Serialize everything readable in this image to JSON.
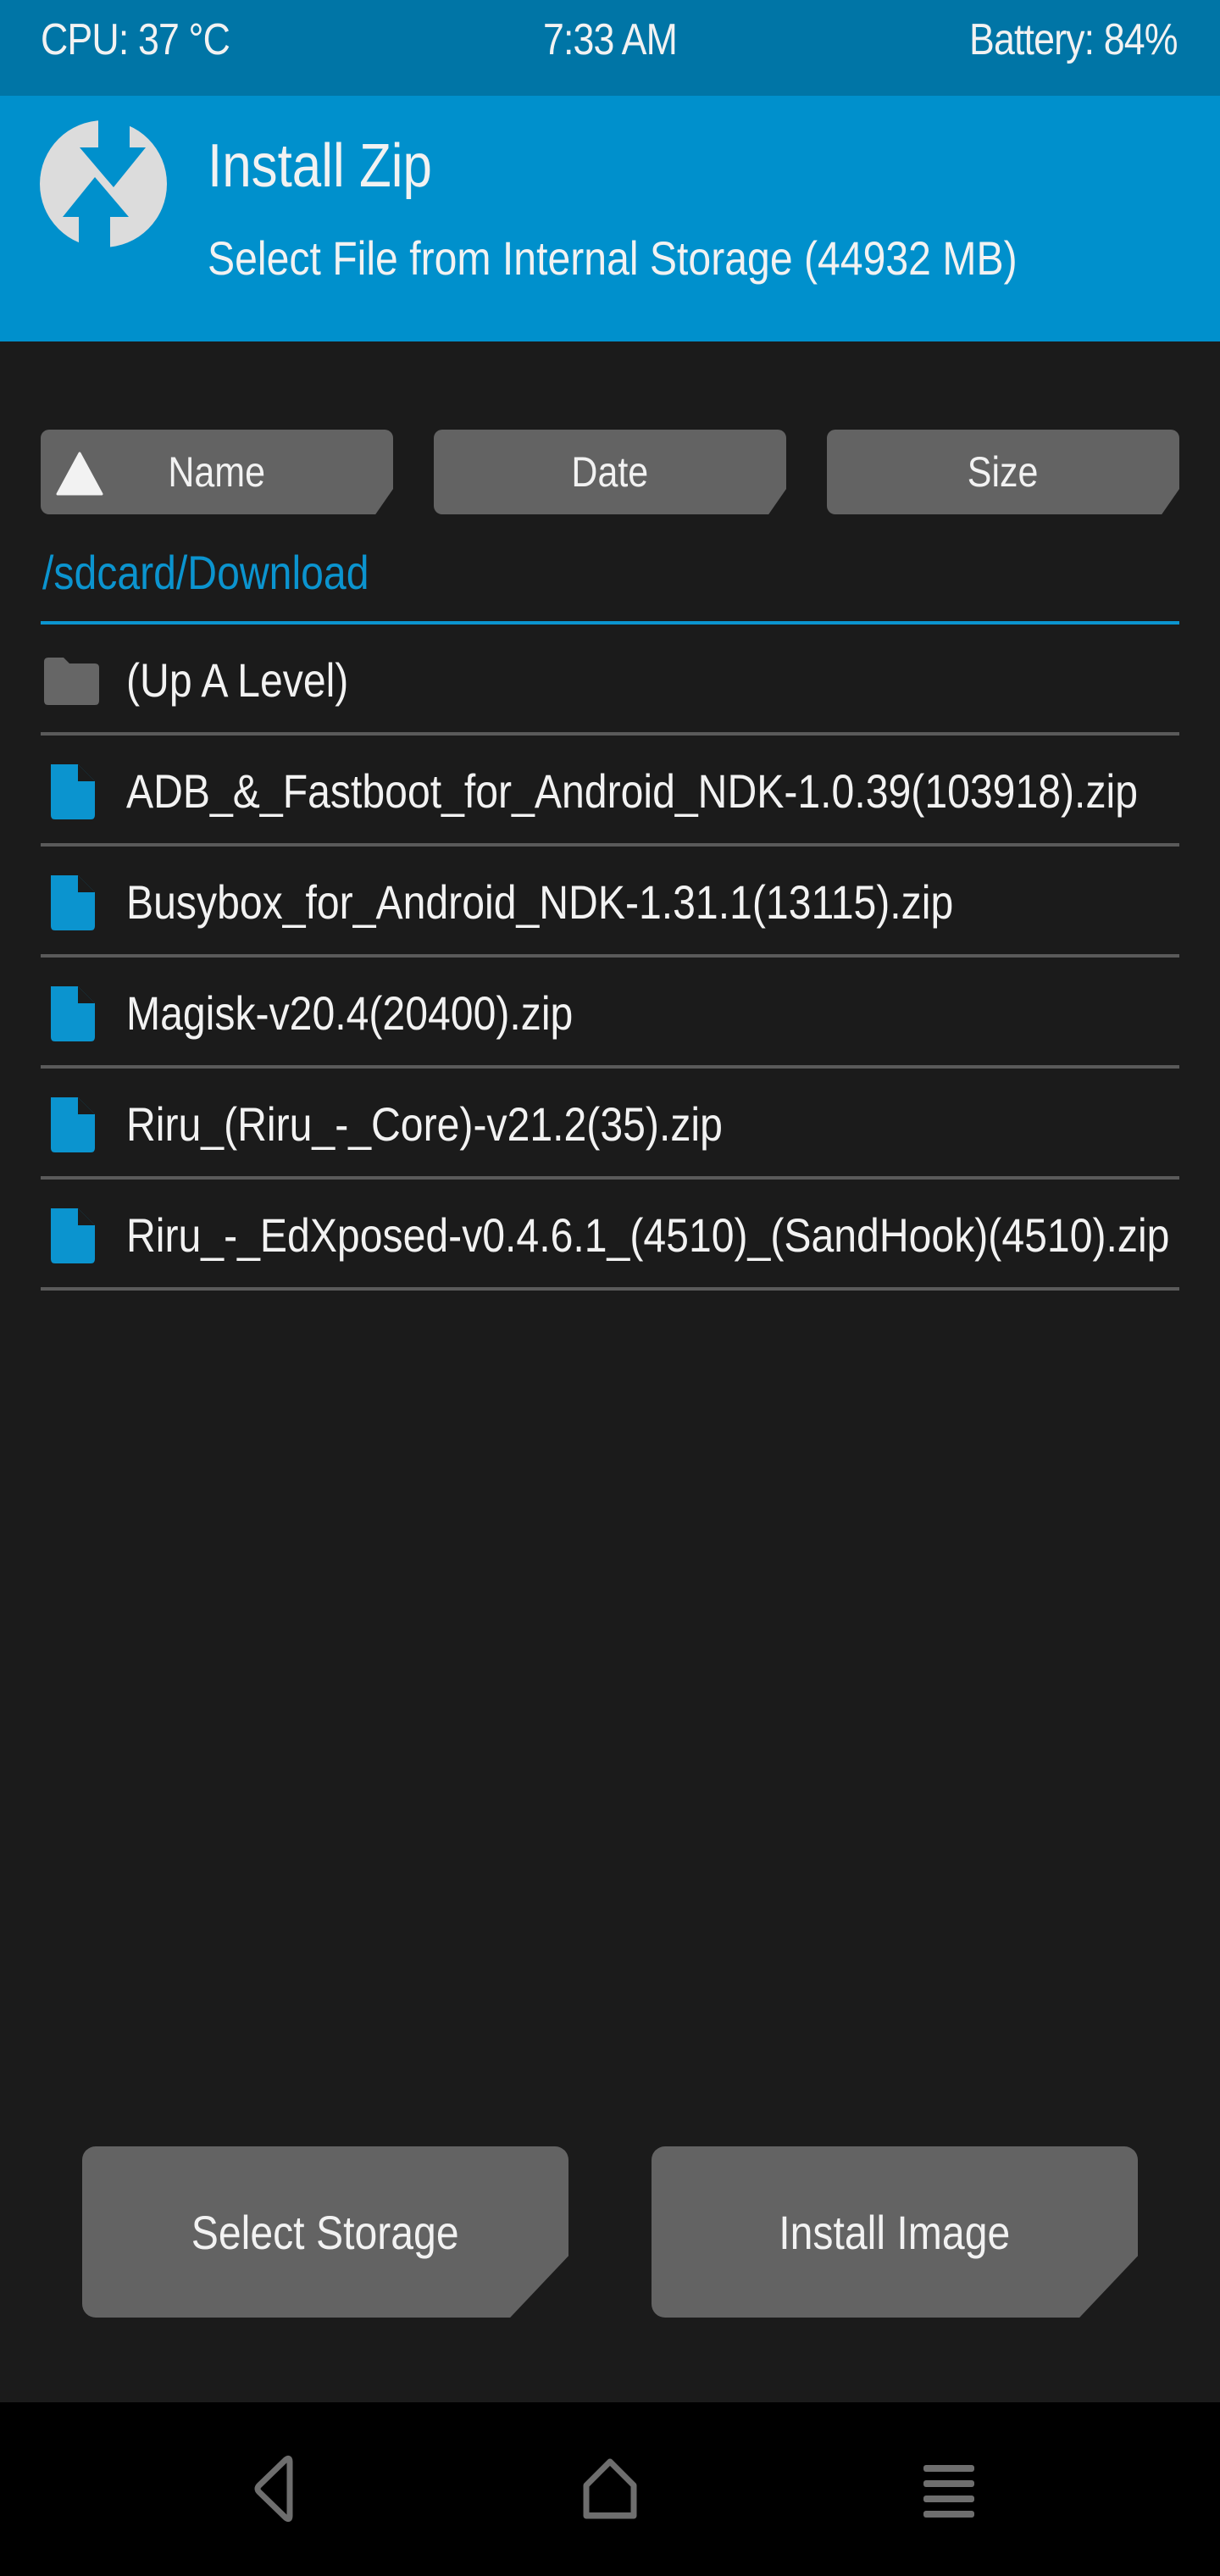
{
  "status_bar": {
    "cpu": "CPU: 37 °C",
    "time": "7:33 AM",
    "battery": "Battery: 84%"
  },
  "header": {
    "logo_icon": "twrp-logo-icon",
    "title": "Install Zip",
    "subtitle": "Select File from Internal Storage (44932 MB)"
  },
  "sort_buttons": {
    "name": {
      "label": "Name",
      "active": true,
      "direction": "ascending",
      "icon": "sort-ascending-icon"
    },
    "date": {
      "label": "Date"
    },
    "size": {
      "label": "Size"
    }
  },
  "current_path": "/sdcard/Download",
  "files": [
    {
      "name": "(Up A Level)",
      "type": "folder",
      "icon": "folder-icon"
    },
    {
      "name": "ADB_&_Fastboot_for_Android_NDK-1.0.39(103918).zip",
      "type": "file",
      "icon": "file-icon"
    },
    {
      "name": "Busybox_for_Android_NDK-1.31.1(13115).zip",
      "type": "file",
      "icon": "file-icon"
    },
    {
      "name": "Magisk-v20.4(20400).zip",
      "type": "file",
      "icon": "file-icon"
    },
    {
      "name": "Riru_(Riru_-_Core)-v21.2(35).zip",
      "type": "file",
      "icon": "file-icon"
    },
    {
      "name": "Riru_-_EdXposed-v0.4.6.1_(4510)_(SandHook)(4510).zip",
      "type": "file",
      "icon": "file-icon"
    }
  ],
  "actions": {
    "select_storage": "Select Storage",
    "install_image": "Install Image"
  },
  "nav_bar": {
    "back": "back-icon",
    "home": "home-icon",
    "menu": "menu-icon"
  },
  "colors": {
    "status_bar": "#0075a6",
    "header": "#0090cc",
    "accent": "#0b94cf",
    "background": "#1b1b1b",
    "button": "#636363",
    "separator": "#5a5a5a",
    "folder_icon": "#666666",
    "file_icon": "#0b94cf"
  }
}
